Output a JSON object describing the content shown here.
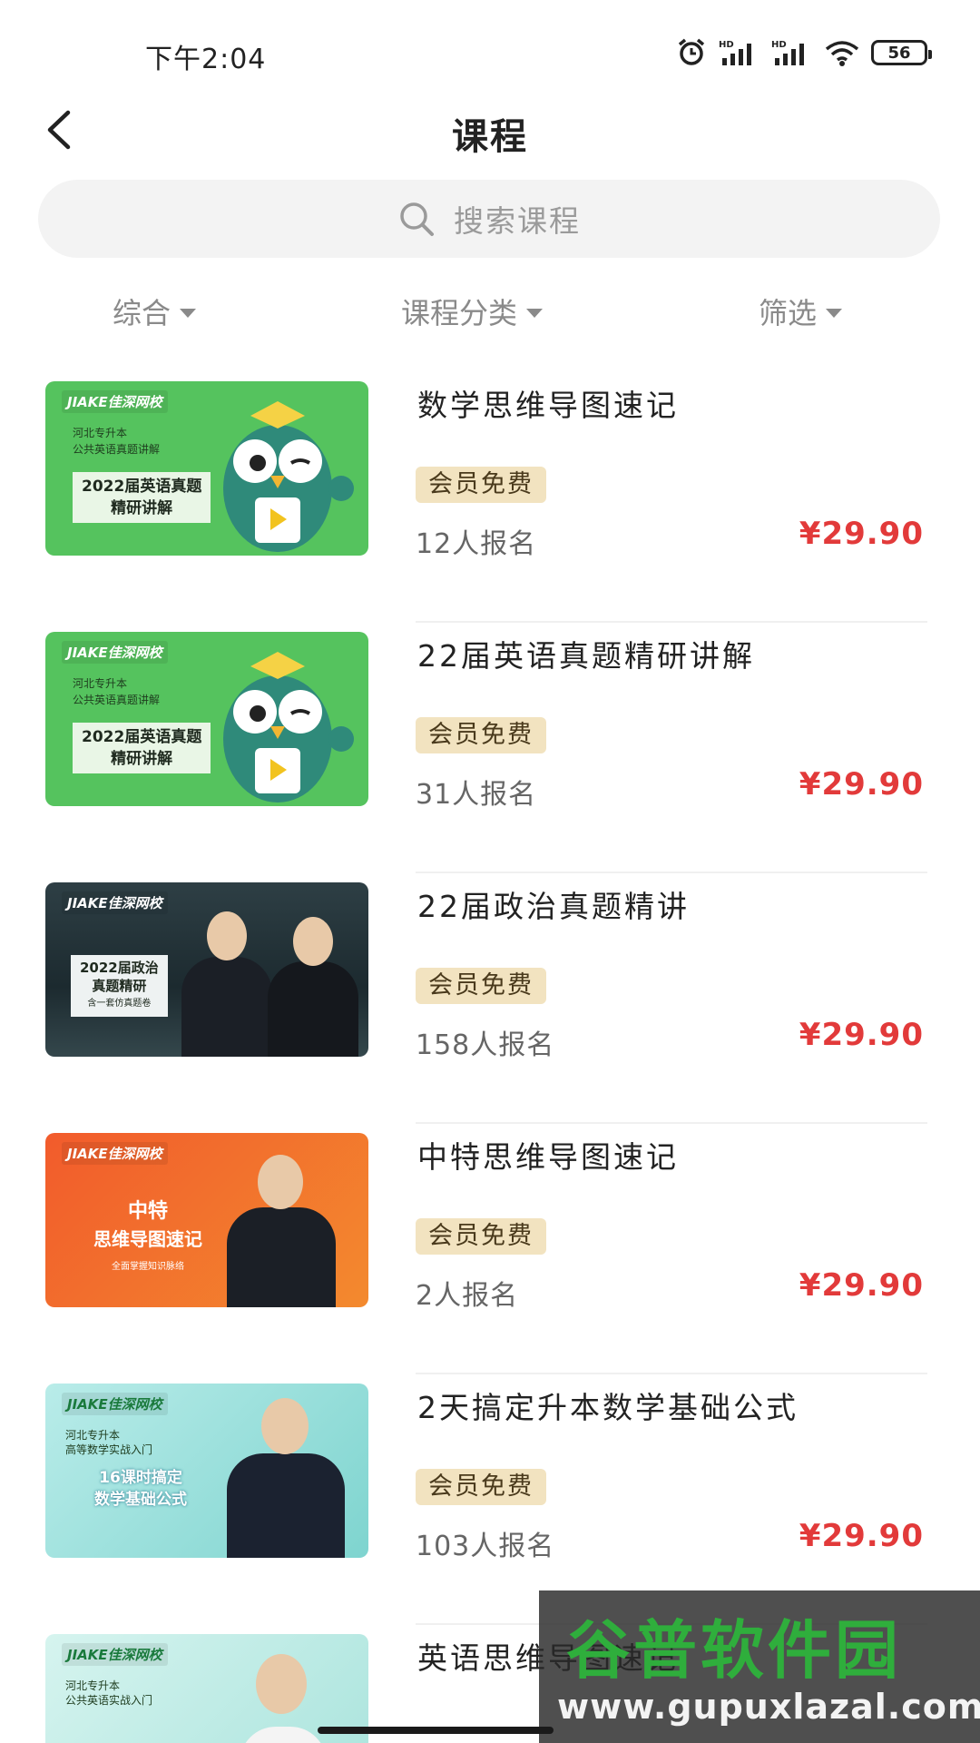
{
  "status_bar": {
    "time": "下午2:04",
    "battery": "56"
  },
  "header": {
    "title": "课程"
  },
  "search": {
    "placeholder": "搜索课程"
  },
  "filters": [
    {
      "label": "综合"
    },
    {
      "label": "课程分类"
    },
    {
      "label": "筛选"
    }
  ],
  "courses": [
    {
      "title": "数学思维导图速记",
      "badge": "会员免费",
      "enrolled": "12人报名",
      "price": "¥29.90",
      "thumb": {
        "brand": "JIAKE佳深网校",
        "line1": "河北专升本",
        "line2": "公共英语真题讲解",
        "box1": "2022届英语真题",
        "box2": "精研讲解"
      }
    },
    {
      "title": "22届英语真题精研讲解",
      "badge": "会员免费",
      "enrolled": "31人报名",
      "price": "¥29.90",
      "thumb": {
        "brand": "JIAKE佳深网校",
        "line1": "河北专升本",
        "line2": "公共英语真题讲解",
        "box1": "2022届英语真题",
        "box2": "精研讲解"
      }
    },
    {
      "title": "22届政治真题精讲",
      "badge": "会员免费",
      "enrolled": "158人报名",
      "price": "¥29.90",
      "thumb": {
        "brand": "JIAKE佳深网校",
        "box1": "2022届政治",
        "box2": "真题精研",
        "box3": "含一套仿真题卷"
      }
    },
    {
      "title": "中特思维导图速记",
      "badge": "会员免费",
      "enrolled": "2人报名",
      "price": "¥29.90",
      "thumb": {
        "brand": "JIAKE佳深网校",
        "box1": "中特",
        "box2": "思维导图速记",
        "box3": "全面掌握知识脉络"
      }
    },
    {
      "title": "2天搞定升本数学基础公式",
      "badge": "会员免费",
      "enrolled": "103人报名",
      "price": "¥29.90",
      "thumb": {
        "brand": "JIAKE佳深网校",
        "line1": "河北专升本",
        "line2": "高等数学实战入门",
        "box1": "16课时搞定",
        "box2": "数学基础公式"
      }
    },
    {
      "title": "英语思维导图速记",
      "thumb": {
        "brand": "JIAKE佳深网校",
        "line1": "河北专升本",
        "line2": "公共英语实战入门"
      }
    }
  ],
  "watermark": {
    "title": "谷普软件园",
    "url": "www.gupuxlazal.com"
  }
}
